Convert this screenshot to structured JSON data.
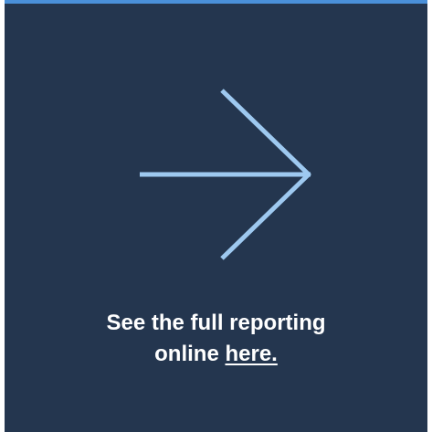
{
  "card": {
    "background_color": "#24364f",
    "accent_color": "#4a90d9",
    "arrow_color": "#9ec9f0"
  },
  "arrow": {
    "icon": "arrow-right-icon"
  },
  "cta": {
    "line1": "See the full reporting",
    "line2_prefix": "online",
    "link_text": "here."
  }
}
